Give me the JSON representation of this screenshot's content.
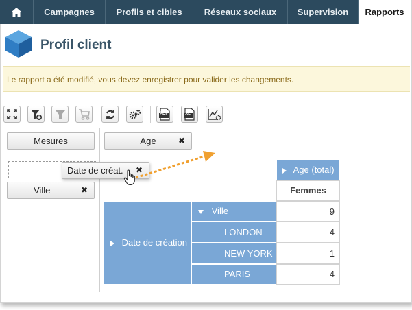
{
  "nav": {
    "home_icon": "home-icon",
    "items": [
      {
        "label": "Campagnes"
      },
      {
        "label": "Profils et cibles"
      },
      {
        "label": "Réseaux sociaux"
      },
      {
        "label": "Supervision"
      },
      {
        "label": "Rapports"
      }
    ],
    "active": "Rapports"
  },
  "page": {
    "title": "Profil client",
    "icon": "cube-icon"
  },
  "warning": {
    "text": "Le rapport a été modifié, vous devez enregistrer pour valider les changements."
  },
  "toolbar": {
    "buttons": [
      "fullscreen-icon",
      "add-filter-icon",
      "filter-icon",
      "cart-icon",
      "refresh-icon",
      "settings-icon",
      "export-pdf-icon",
      "export-excel-icon",
      "chart-settings-icon"
    ],
    "pdf_label": "PDF",
    "xls_label": "XL"
  },
  "pivot": {
    "measures_label": "Mesures",
    "column_dim": {
      "label": "Age",
      "remove": "✖"
    },
    "row_dim": {
      "label": "Ville",
      "remove": "✖"
    },
    "dragging": {
      "label": "Date de créat.",
      "remove": "✖"
    },
    "table": {
      "col_header": "Age (total)",
      "col_sub": "Femmes",
      "row_header": "Date de création",
      "group_label": "Ville",
      "group_value": "9",
      "rows": [
        {
          "label": "LONDON",
          "value": "4"
        },
        {
          "label": "NEW YORK",
          "value": "1"
        },
        {
          "label": "PARIS",
          "value": "4"
        }
      ]
    }
  },
  "colors": {
    "nav_bg": "#2c4a5e",
    "accent_blue": "#7aa7d6",
    "warning_bg": "#fcf7dc",
    "warning_text": "#8a6a1a",
    "drag_arrow": "#f0a030"
  }
}
